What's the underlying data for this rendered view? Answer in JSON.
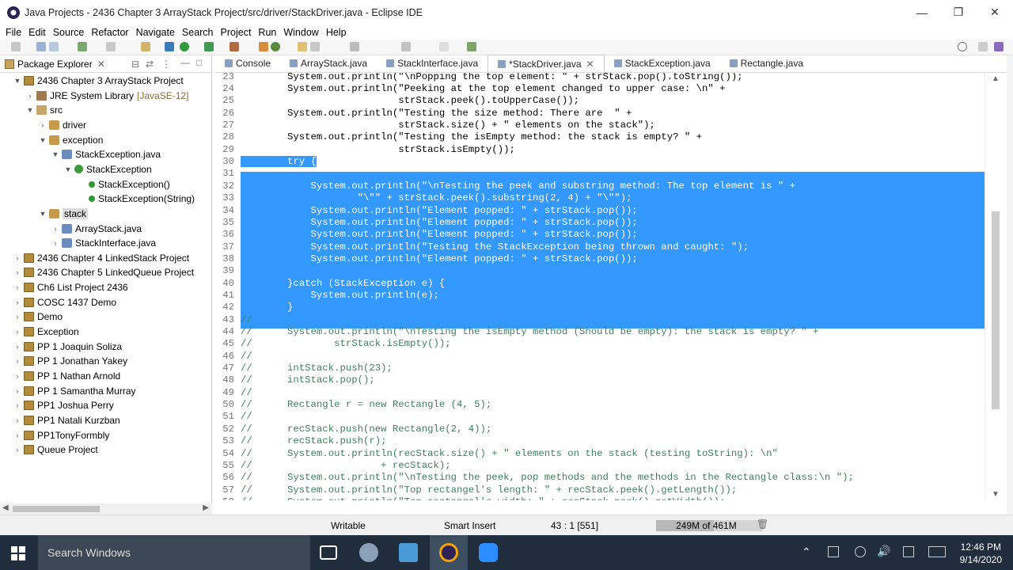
{
  "window": {
    "title": "Java Projects - 2436 Chapter 3 ArrayStack Project/src/driver/StackDriver.java - Eclipse IDE",
    "minimize": "—",
    "restore": "❐",
    "close": "✕"
  },
  "menu": [
    "File",
    "Edit",
    "Source",
    "Refactor",
    "Navigate",
    "Search",
    "Project",
    "Run",
    "Window",
    "Help"
  ],
  "package_explorer": {
    "title": "Package Explorer",
    "tree": [
      {
        "label": "2436 Chapter 3 ArrayStack Project",
        "icon": "project-icon",
        "depth": 0,
        "twist": "▼"
      },
      {
        "label": "JRE System Library",
        "extra": "[JavaSE-12]",
        "icon": "library-icon",
        "depth": 1,
        "twist": "›"
      },
      {
        "label": "src",
        "icon": "folder-icon",
        "depth": 1,
        "twist": "▼"
      },
      {
        "label": "driver",
        "icon": "package-icon",
        "depth": 2,
        "twist": "›"
      },
      {
        "label": "exception",
        "icon": "package-icon",
        "depth": 2,
        "twist": "▼"
      },
      {
        "label": "StackException.java",
        "icon": "java-file-icon",
        "depth": 3,
        "twist": "▼"
      },
      {
        "label": "StackException",
        "icon": "class-icon",
        "depth": 4,
        "twist": "▼"
      },
      {
        "label": "StackException()",
        "icon": "method-icon",
        "depth": 5,
        "twist": ""
      },
      {
        "label": "StackException(String)",
        "icon": "method-icon",
        "depth": 5,
        "twist": ""
      },
      {
        "label": "stack",
        "icon": "package-icon",
        "depth": 2,
        "twist": "▼",
        "selected": true
      },
      {
        "label": "ArrayStack.java",
        "icon": "java-file-icon",
        "depth": 3,
        "twist": "›"
      },
      {
        "label": "StackInterface.java",
        "icon": "java-file-icon",
        "depth": 3,
        "twist": "›"
      },
      {
        "label": "2436 Chapter 4 LinkedStack Project",
        "icon": "project-icon",
        "depth": 0,
        "twist": "›"
      },
      {
        "label": "2436 Chapter 5 LinkedQueue Project",
        "icon": "project-icon",
        "depth": 0,
        "twist": "›"
      },
      {
        "label": "Ch6 List Project 2436",
        "icon": "project-icon",
        "depth": 0,
        "twist": "›"
      },
      {
        "label": "COSC 1437 Demo",
        "icon": "project-icon",
        "depth": 0,
        "twist": "›"
      },
      {
        "label": "Demo",
        "icon": "project-icon",
        "depth": 0,
        "twist": "›"
      },
      {
        "label": "Exception",
        "icon": "project-icon",
        "depth": 0,
        "twist": "›"
      },
      {
        "label": "PP 1 Joaquin Soliza",
        "icon": "project-icon",
        "depth": 0,
        "twist": "›"
      },
      {
        "label": "PP 1 Jonathan Yakey",
        "icon": "project-icon",
        "depth": 0,
        "twist": "›"
      },
      {
        "label": "PP 1 Nathan Arnold",
        "icon": "project-icon",
        "depth": 0,
        "twist": "›"
      },
      {
        "label": "PP 1 Samantha Murray",
        "icon": "project-icon",
        "depth": 0,
        "twist": "›"
      },
      {
        "label": "PP1 Joshua Perry",
        "icon": "project-icon",
        "depth": 0,
        "twist": "›"
      },
      {
        "label": "PP1 Natali Kurzban",
        "icon": "project-icon",
        "depth": 0,
        "twist": "›"
      },
      {
        "label": "PP1TonyFormbly",
        "icon": "project-icon",
        "depth": 0,
        "twist": "›"
      },
      {
        "label": "Queue Project",
        "icon": "project-icon",
        "depth": 0,
        "twist": "›"
      }
    ]
  },
  "editor_tabs": [
    {
      "label": "Console",
      "active": false
    },
    {
      "label": "ArrayStack.java",
      "active": false
    },
    {
      "label": "StackInterface.java",
      "active": false
    },
    {
      "label": "*StackDriver.java",
      "active": true
    },
    {
      "label": "StackException.java",
      "active": false
    },
    {
      "label": "Rectangle.java",
      "active": false
    }
  ],
  "code_lines": [
    {
      "n": "23",
      "t": "        System.out.println(\"\\nPopping the top element: \" + strStack.pop().toString());",
      "sel": false
    },
    {
      "n": "24",
      "t": "        System.out.println(\"Peeking at the top element changed to upper case: \\n\" +",
      "sel": false
    },
    {
      "n": "25",
      "t": "                           strStack.peek().toUpperCase());",
      "sel": false
    },
    {
      "n": "26",
      "t": "        System.out.println(\"Testing the size method: There are  \" +",
      "sel": false
    },
    {
      "n": "27",
      "t": "                           strStack.size() + \" elements on the stack\");",
      "sel": false
    },
    {
      "n": "28",
      "t": "        System.out.println(\"Testing the isEmpty method: the stack is empty? \" +",
      "sel": false
    },
    {
      "n": "29",
      "t": "                           strStack.isEmpty());",
      "sel": false
    },
    {
      "n": "30",
      "t": "        try {",
      "sel": true
    },
    {
      "n": "31",
      "t": "",
      "sel": true
    },
    {
      "n": "32",
      "t": "            System.out.println(\"\\nTesting the peek and substring method: The top element is \" +",
      "sel": true
    },
    {
      "n": "33",
      "t": "                    \"\\\"\" + strStack.peek().substring(2, 4) + \"\\\"\");",
      "sel": true
    },
    {
      "n": "34",
      "t": "            System.out.println(\"Element popped: \" + strStack.pop());",
      "sel": true
    },
    {
      "n": "35",
      "t": "            System.out.println(\"Element popped: \" + strStack.pop());",
      "sel": true
    },
    {
      "n": "36",
      "t": "            System.out.println(\"Element popped: \" + strStack.pop());",
      "sel": true
    },
    {
      "n": "37",
      "t": "            System.out.println(\"Testing the StackException being thrown and caught: \");",
      "sel": true
    },
    {
      "n": "38",
      "t": "            System.out.println(\"Element popped: \" + strStack.pop());",
      "sel": true
    },
    {
      "n": "39",
      "t": "",
      "sel": true
    },
    {
      "n": "40",
      "t": "        }catch (StackException e) {",
      "sel": true
    },
    {
      "n": "41",
      "t": "            System.out.println(e);",
      "sel": true
    },
    {
      "n": "42",
      "t": "        }",
      "sel": true
    },
    {
      "n": "43",
      "t": "//",
      "sel": false
    },
    {
      "n": "44",
      "t": "//      System.out.println(\"\\nTesting the isEmpty method (Should be empty): the stack is empty? \" +",
      "sel": false
    },
    {
      "n": "45",
      "t": "//              strStack.isEmpty());",
      "sel": false
    },
    {
      "n": "46",
      "t": "//",
      "sel": false
    },
    {
      "n": "47",
      "t": "//      intStack.push(23);",
      "sel": false
    },
    {
      "n": "48",
      "t": "//      intStack.pop();",
      "sel": false
    },
    {
      "n": "49",
      "t": "//",
      "sel": false
    },
    {
      "n": "50",
      "t": "//      Rectangle r = new Rectangle (4, 5);",
      "sel": false
    },
    {
      "n": "51",
      "t": "//",
      "sel": false
    },
    {
      "n": "52",
      "t": "//      recStack.push(new Rectangle(2, 4));",
      "sel": false
    },
    {
      "n": "53",
      "t": "//      recStack.push(r);",
      "sel": false
    },
    {
      "n": "54",
      "t": "//      System.out.println(recStack.size() + \" elements on the stack (testing toString): \\n\"",
      "sel": false
    },
    {
      "n": "55",
      "t": "//                      + recStack);",
      "sel": false
    },
    {
      "n": "56",
      "t": "//      System.out.println(\"\\nTesting the peek, pop methods and the methods in the Rectangle class:\\n \");",
      "sel": false
    },
    {
      "n": "57",
      "t": "//      System.out.println(\"Top rectangel's length: \" + recStack.peek().getLength());",
      "sel": false
    },
    {
      "n": "58",
      "t": "//      System.out.println(\"Top rectangel's width: \" + recStack.peek().getWidth());",
      "sel": false
    }
  ],
  "status": {
    "writable": "Writable",
    "insert_mode": "Smart Insert",
    "position": "43 : 1 [551]",
    "heap": "249M of 461M",
    "heap_fraction": 0.54
  },
  "taskbar": {
    "search": "Search Windows",
    "time": "12:46 PM",
    "date": "9/14/2020"
  },
  "colors": {
    "selection": "#3399ff",
    "keyword": "#7f0055",
    "string": "#2a00ff",
    "comment": "#3f7f5f",
    "taskbar": "#1f2d3c"
  }
}
